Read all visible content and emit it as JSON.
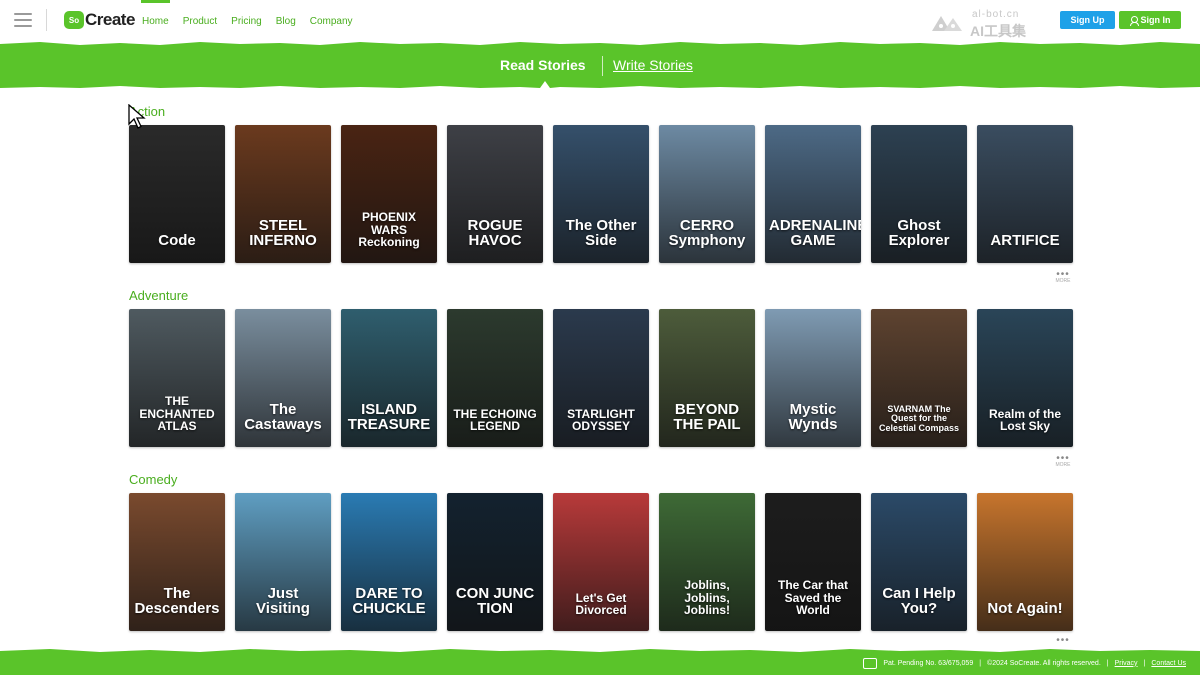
{
  "nav": {
    "logo_mark": "So",
    "logo_text": "Create",
    "links": [
      "Home",
      "Product",
      "Pricing",
      "Blog",
      "Company"
    ],
    "active_link": "Home",
    "watermark_line1": "al-bot.cn",
    "watermark_line2": "AI工具集",
    "signup_label": "Sign Up",
    "signin_label": "Sign In"
  },
  "banner": {
    "read_label": "Read Stories",
    "write_label": "Write Stories"
  },
  "colors": {
    "brand_green": "#5ac42a",
    "link_green": "#4aae1f",
    "signup_blue": "#1ea1e8"
  },
  "sections": [
    {
      "title": "Action",
      "more_label": "MORE",
      "stories": [
        {
          "title": "Code",
          "bg": "#2a2a2a"
        },
        {
          "title": "STEEL INFERNO",
          "bg": "#6b3a1e"
        },
        {
          "title": "PHOENIX WARS Reckoning",
          "bg": "#4a2413"
        },
        {
          "title": "ROGUE HAVOC",
          "bg": "#3e4046"
        },
        {
          "title": "The Other Side",
          "bg": "#35506b"
        },
        {
          "title": "CERRO Symphony",
          "bg": "#6d8aa3"
        },
        {
          "title": "ADRENALINE GAME",
          "bg": "#4d6a86"
        },
        {
          "title": "Ghost Explorer",
          "bg": "#2d4152"
        },
        {
          "title": "ARTIFICE",
          "bg": "#3a4d60"
        }
      ]
    },
    {
      "title": "Adventure",
      "more_label": "MORE",
      "stories": [
        {
          "title": "THE ENCHANTED ATLAS",
          "bg": "#4f5a60"
        },
        {
          "title": "The Castaways",
          "bg": "#7a8e9e"
        },
        {
          "title": "ISLAND TREASURE",
          "bg": "#2f5e6e"
        },
        {
          "title": "THE ECHOING LEGEND",
          "bg": "#2c3a2e"
        },
        {
          "title": "STARLIGHT ODYSSEY",
          "bg": "#2b3a4d"
        },
        {
          "title": "BEYOND THE PAIL",
          "bg": "#4d5c3b"
        },
        {
          "title": "Mystic Wynds",
          "bg": "#7f9bb3"
        },
        {
          "title": "SVARNAM The Quest for the Celestial Compass",
          "bg": "#5e4330"
        },
        {
          "title": "Realm of the Lost Sky",
          "bg": "#2a4558"
        }
      ]
    },
    {
      "title": "Comedy",
      "more_label": "MORE",
      "stories": [
        {
          "title": "The Descenders",
          "bg": "#7a4a2e"
        },
        {
          "title": "Just Visiting",
          "bg": "#5f9ec2"
        },
        {
          "title": "DARE TO CHUCKLE",
          "bg": "#2a7bb3"
        },
        {
          "title": "CON JUNC TION",
          "bg": "#13222f"
        },
        {
          "title": "Let's Get Divorced",
          "bg": "#b83a3a"
        },
        {
          "title": "Joblins, Joblins, Joblins!",
          "bg": "#3e6a36"
        },
        {
          "title": "The Car that Saved the World",
          "bg": "#1d1d1d"
        },
        {
          "title": "Can I Help You?",
          "bg": "#2b4a68"
        },
        {
          "title": "Not Again!",
          "bg": "#c7752d"
        }
      ]
    }
  ],
  "footer": {
    "patent": "Pat. Pending No. 63/675,059",
    "copyright": "©2024 SoCreate. All rights reserved.",
    "privacy": "Privacy",
    "contact": "Contact Us"
  }
}
